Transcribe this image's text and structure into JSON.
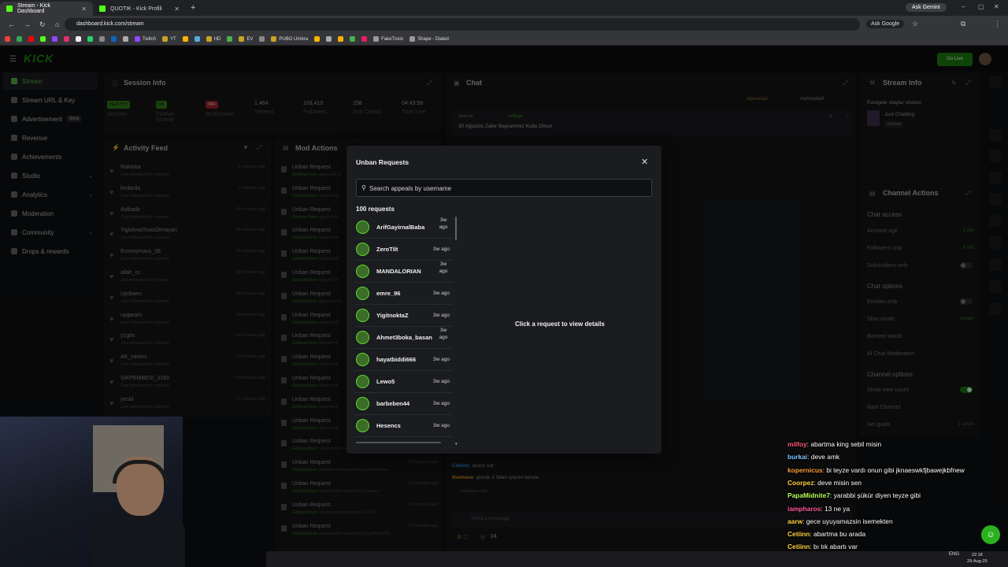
{
  "browser": {
    "tabs": [
      {
        "title": "Stream - Kick Dashboard",
        "active": true
      },
      {
        "title": "QUOTIK - Kick Profili",
        "active": false
      }
    ],
    "ask_gemini": "Ask Gemini",
    "url": "dashboard.kick.com/stream",
    "ask_google": "Ask Google",
    "bookmarks": [
      "Twitch",
      "YT",
      "HD",
      "EV",
      "PUBG Umbra",
      "FakeTruck",
      "Shape - Dialed"
    ]
  },
  "kick": {
    "logo": "KICK",
    "go_live": "Go Live",
    "sidebar": [
      {
        "label": "Stream",
        "active": true
      },
      {
        "label": "Stream URL & Key"
      },
      {
        "label": "Advertisement",
        "badge": "Beta"
      },
      {
        "label": "Revenue"
      },
      {
        "label": "Achievements"
      },
      {
        "label": "Studio",
        "expandable": true
      },
      {
        "label": "Analytics",
        "expandable": true
      },
      {
        "label": "Moderation"
      },
      {
        "label": "Community",
        "expandable": true
      },
      {
        "label": "Drops & rewards"
      }
    ],
    "session_info": {
      "title": "Session Info",
      "stats": [
        {
          "value": "HEALTHY",
          "label": "Session",
          "kind": "badge-green"
        },
        {
          "value": "ON",
          "label": "Partner Income",
          "kind": "badge-green"
        },
        {
          "value": "OFF",
          "label": "Multistream",
          "kind": "badge-red"
        },
        {
          "value": "1,464",
          "label": "Viewers"
        },
        {
          "value": "103,410",
          "label": "Followers"
        },
        {
          "value": "158",
          "label": "Sub Counts"
        },
        {
          "value": "04:43:58",
          "label": "Time Live"
        }
      ]
    },
    "activity_feed": {
      "title": "Activity Feed",
      "items": [
        {
          "name": "Raktoka",
          "sub": "Just followed the channel",
          "time": "5 minutes ago"
        },
        {
          "name": "lxrdarda",
          "sub": "Just followed the channel",
          "time": "7 minutes ago"
        },
        {
          "name": "Asfkadir",
          "sub": "Just followed the channel",
          "time": "13 minutes ago"
        },
        {
          "name": "YigitAmaToxicOlmayan",
          "sub": "Just followed the channel",
          "time": "15 minutes ago"
        },
        {
          "name": "Euronymous_38",
          "sub": "Just followed the channel",
          "time": "16 minutes ago"
        },
        {
          "name": "allah_cc",
          "sub": "Just followed the channel",
          "time": "23 minutes ago"
        },
        {
          "name": "Updraen",
          "sub": "Just followed the channel",
          "time": "39 minutes ago"
        },
        {
          "name": "uygaram",
          "sub": "Just followed the channel",
          "time": "40 minutes ago"
        },
        {
          "name": "y1gitx",
          "sub": "Just followed the channel",
          "time": "50 minutes ago"
        },
        {
          "name": "AK_misirci",
          "sub": "Just followed the channel",
          "time": "53 minutes ago"
        },
        {
          "name": "SIKPEMBESI_3169",
          "sub": "Just followed the channel",
          "time": "53 minutes ago"
        },
        {
          "name": "yesid",
          "sub": "Just followed the channel",
          "time": "57 minutes ago"
        }
      ]
    },
    "mod_actions": {
      "title": "Mod Actions",
      "items": [
        {
          "name": "Unban Request",
          "by": "GokhanOner",
          "sub": "approved th"
        },
        {
          "name": "Unban Request",
          "by": "GokhanOner",
          "sub": "rejected th"
        },
        {
          "name": "Unban Request",
          "by": "GokhanOner",
          "sub": "rejected th"
        },
        {
          "name": "Unban Request",
          "by": "GokhanOner",
          "sub": "rejected th"
        },
        {
          "name": "Unban Request",
          "by": "GokhanOner",
          "sub": "rejected th"
        },
        {
          "name": "Unban Request",
          "by": "GokhanOner",
          "sub": "rejected th"
        },
        {
          "name": "Unban Request",
          "by": "GokhanOner",
          "sub": "approved th"
        },
        {
          "name": "Unban Request",
          "by": "GokhanOner",
          "sub": "rejected th"
        },
        {
          "name": "Unban Request",
          "by": "GokhanOner",
          "sub": "rejected th"
        },
        {
          "name": "Unban Request",
          "by": "GokhanOner",
          "sub": "rejected th"
        },
        {
          "name": "Unban Request",
          "by": "GokhanOner",
          "sub": "rejected th"
        },
        {
          "name": "Unban Request",
          "by": "GokhanOner",
          "sub": "rejected th"
        },
        {
          "name": "Unban Request",
          "by": "GokhanOner",
          "sub": "rejected th"
        },
        {
          "name": "Unban Request",
          "by": "GokhanOner",
          "sub": "rejected the request by 01cipenty"
        },
        {
          "name": "Unban Request",
          "by": "GokhanOner",
          "sub": "rejected the request by actinuhatmat",
          "time": "10 minutes ago"
        },
        {
          "name": "Unban Request",
          "by": "GokhanOner",
          "sub": "rejected the request by boraacv",
          "time": "10 minutes ago"
        },
        {
          "name": "Unban Request",
          "by": "GokhanOner",
          "sub": "rejected the request by FITTR",
          "time": "10 minutes ago"
        },
        {
          "name": "Unban Request",
          "by": "GokhanOner",
          "sub": "rejected the request by knightlight200",
          "time": "10 minutes ago"
        }
      ]
    },
    "chat": {
      "title": "Chat",
      "pinned_by": "Sent by",
      "pinned_user": "kuflaga",
      "pinned_text": "30 Ağustos Zafer Bayrammız Kutlu Olsun",
      "top_users": [
        "alperasian",
        "mehmedarf"
      ],
      "lines": [
        {
          "user": "Cetiinn",
          "text": ": abartı var"
        },
        {
          "user": "themaoo",
          "text": ": günde 5 falan içiyom bende"
        }
      ],
      "followers_only": "Followers only",
      "input_placeholder": "Send a message",
      "count": "24"
    },
    "stream_info": {
      "title": "Stream Info",
      "stream_title": "Rastgele olaylar silsilesi",
      "category": "Just Chatting",
      "language": "Turkish"
    },
    "channel_actions": {
      "title": "Channel Actions",
      "chat_access": "Chat access",
      "account_age": {
        "label": "Account age",
        "value": "1 day"
      },
      "followers_only": {
        "label": "Followers only",
        "value": "6 min"
      },
      "subscribers_only": "Subscribers only",
      "chat_options": "Chat options",
      "emotes_only": "Emotes only",
      "slow_mode": {
        "label": "Slow mode",
        "value": "Instant"
      },
      "banned_words": "Banned words",
      "ai_moderation": "AI Chat Moderation",
      "channel_options": "Channel options",
      "show_viewer_count": "Show view count",
      "raid_channel": "Raid Channel",
      "set_goals": {
        "label": "Set goals",
        "value": "1 active"
      }
    }
  },
  "modal": {
    "title": "Unban Requests",
    "search_placeholder": "Search appeals by username",
    "count_label": "100 requests",
    "requests": [
      {
        "name": "ArifGayirnalBaba",
        "time": "3w ago",
        "wrap": true
      },
      {
        "name": "ZeroTilt",
        "time": "3w ago"
      },
      {
        "name": "MANDALORIAN",
        "time": "3w ago",
        "wrap": true
      },
      {
        "name": "emre_96",
        "time": "3w ago"
      },
      {
        "name": "YigitnoktaZ",
        "time": "3w ago"
      },
      {
        "name": "Ahmet3boka_basan",
        "time": "3w ago",
        "wrap": true
      },
      {
        "name": "hayatbiddi666",
        "time": "3w ago"
      },
      {
        "name": "Lewo5",
        "time": "3w ago"
      },
      {
        "name": "barbeben44",
        "time": "3w ago"
      },
      {
        "name": "Hesencs",
        "time": "3w ago"
      }
    ],
    "detail_hint": "Click a request to view details"
  },
  "overlay_chat": [
    {
      "user": "milfoy",
      "color": "#ff5b7a",
      "text": ": abartma king sebil misin"
    },
    {
      "user": "burkai",
      "color": "#7fc4ff",
      "text": ": deve amk"
    },
    {
      "user": "kopernicus",
      "color": "#ff9a3c",
      "text": ": bi teyze vardı onun gibi jknaeswkfjbawejkbfnew"
    },
    {
      "user": "Coorpez",
      "color": "#ffd23c",
      "text": ": deve misin sen"
    },
    {
      "user": "PapaMidnite7",
      "color": "#b6ff5a",
      "text": ": yarabbi şükür diyen teyze gibi"
    },
    {
      "user": "iampharos",
      "color": "#ff5b9a",
      "text": ": 13 ne ya"
    },
    {
      "user": "aarw",
      "color": "#ffd23c",
      "text": ": gece uyuyamazsin isemekten"
    },
    {
      "user": "Cetiinn",
      "color": "#ffd23c",
      "text": ": abartma bu arada"
    },
    {
      "user": "Cetiinn",
      "color": "#ffd23c",
      "text": ": bı tık abartı var"
    },
    {
      "user": "themaoo",
      "color": "#ffd23c",
      "text": ": günde 5 falan içiyom bende"
    }
  ],
  "taskbar": {
    "lang": "ENG",
    "time": "22:18",
    "date": "29-Aug-25"
  }
}
